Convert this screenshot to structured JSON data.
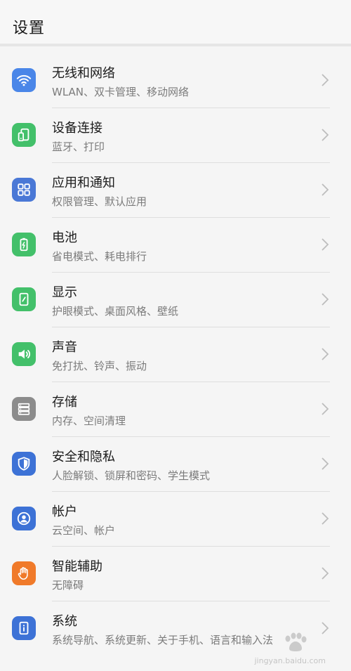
{
  "header": {
    "title": "设置"
  },
  "items": [
    {
      "title": "无线和网络",
      "subtitle": "WLAN、双卡管理、移动网络",
      "icon": "wifi-icon",
      "color": "#4a86e8"
    },
    {
      "title": "设备连接",
      "subtitle": "蓝牙、打印",
      "icon": "device-connection-icon",
      "color": "#43c06a"
    },
    {
      "title": "应用和通知",
      "subtitle": "权限管理、默认应用",
      "icon": "apps-icon",
      "color": "#4a78d6"
    },
    {
      "title": "电池",
      "subtitle": "省电模式、耗电排行",
      "icon": "battery-icon",
      "color": "#43c06a"
    },
    {
      "title": "显示",
      "subtitle": "护眼模式、桌面风格、壁纸",
      "icon": "display-icon",
      "color": "#43c06a"
    },
    {
      "title": "声音",
      "subtitle": "免打扰、铃声、振动",
      "icon": "sound-icon",
      "color": "#43c06a"
    },
    {
      "title": "存储",
      "subtitle": "内存、空间清理",
      "icon": "storage-icon",
      "color": "#8c8c8c"
    },
    {
      "title": "安全和隐私",
      "subtitle": "人脸解锁、锁屏和密码、学生模式",
      "icon": "shield-icon",
      "color": "#3d72d6"
    },
    {
      "title": "帐户",
      "subtitle": "云空间、帐户",
      "icon": "account-icon",
      "color": "#3d72d6"
    },
    {
      "title": "智能辅助",
      "subtitle": "无障碍",
      "icon": "hand-icon",
      "color": "#f07a2a"
    },
    {
      "title": "系统",
      "subtitle": "系统导航、系统更新、关于手机、语言和输入法",
      "icon": "system-icon",
      "color": "#3d72d6"
    }
  ],
  "watermark": {
    "text": "jingyan.baidu.com"
  }
}
